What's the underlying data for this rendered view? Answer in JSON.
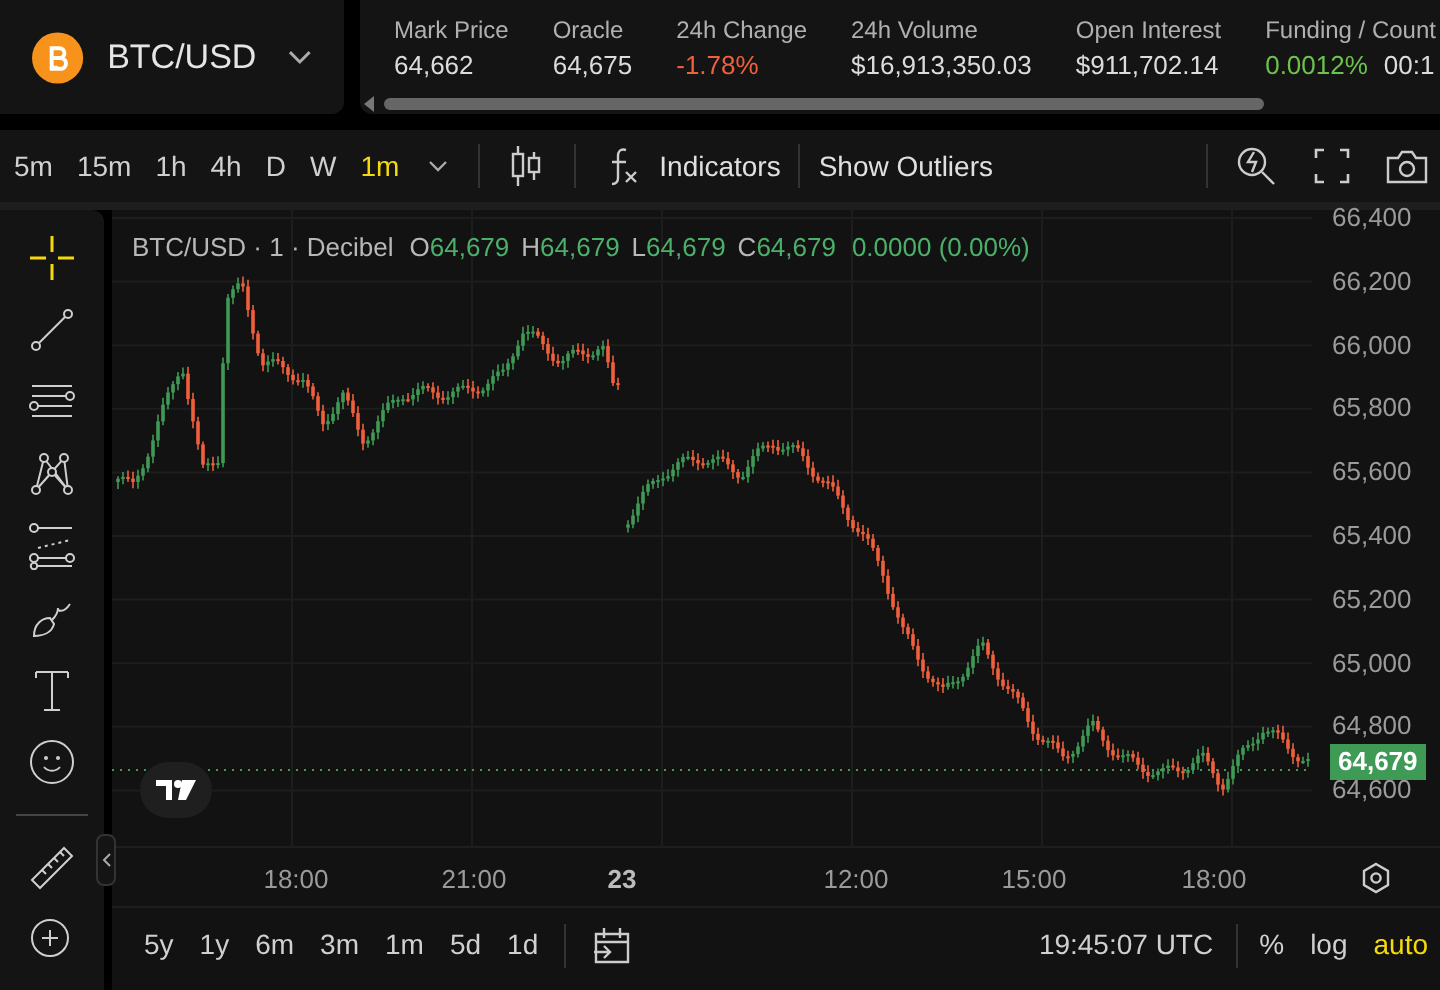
{
  "symbol": {
    "pair": "BTC/USD"
  },
  "stats": [
    {
      "label": "Mark Price",
      "value": "64,662"
    },
    {
      "label": "Oracle",
      "value": "64,675"
    },
    {
      "label": "24h Change",
      "value": "-1.78%",
      "color": "#f0603c"
    },
    {
      "label": "24h Volume",
      "value": "$16,913,350.03"
    },
    {
      "label": "Open Interest",
      "value": "$911,702.14"
    },
    {
      "label": "Funding / Count",
      "value": "0.0012%",
      "color": "#6cc24a",
      "extra": "00:1"
    }
  ],
  "timeframes": [
    {
      "label": "5m",
      "selected": false
    },
    {
      "label": "15m",
      "selected": false
    },
    {
      "label": "1h",
      "selected": false
    },
    {
      "label": "4h",
      "selected": false
    },
    {
      "label": "D",
      "selected": false
    },
    {
      "label": "W",
      "selected": false
    },
    {
      "label": "1m",
      "selected": true
    }
  ],
  "toolbar": {
    "indicators": "Indicators",
    "outliers": "Show Outliers"
  },
  "legend": {
    "title": "BTC/USD · 1 · Decibel",
    "ohlc": [
      {
        "key": "O",
        "value": "64,679"
      },
      {
        "key": "H",
        "value": "64,679"
      },
      {
        "key": "L",
        "value": "64,679"
      },
      {
        "key": "C",
        "value": "64,679"
      }
    ],
    "change": "0.0000 (0.00%)"
  },
  "drawing_tools": [
    {
      "kind": "crosshair",
      "selected": true
    },
    {
      "kind": "trendline",
      "selected": false
    },
    {
      "kind": "hlines",
      "selected": false
    },
    {
      "kind": "pattern",
      "selected": false
    },
    {
      "kind": "fib",
      "selected": false
    },
    {
      "kind": "brush",
      "selected": false
    },
    {
      "kind": "text",
      "selected": false
    },
    {
      "kind": "emoji",
      "selected": false
    },
    {
      "kind": "ruler",
      "selected": false
    },
    {
      "kind": "zoom",
      "selected": false
    }
  ],
  "y_axis": {
    "ticks": [
      "66,400",
      "66,200",
      "66,000",
      "65,800",
      "65,600",
      "65,400",
      "65,200",
      "65,000",
      "64,800",
      "64,600"
    ],
    "current_price": "64,679"
  },
  "x_axis": [
    {
      "label": "18:00",
      "kind": "time"
    },
    {
      "label": "21:00",
      "kind": "time"
    },
    {
      "label": "23",
      "kind": "day"
    },
    {
      "label": "12:00",
      "kind": "time"
    },
    {
      "label": "15:00",
      "kind": "time"
    },
    {
      "label": "18:00",
      "kind": "time"
    }
  ],
  "ranges": [
    "5y",
    "1y",
    "6m",
    "3m",
    "1m",
    "5d",
    "1d"
  ],
  "clock": "19:45:07 UTC",
  "scale_options": [
    {
      "label": "%",
      "selected": false
    },
    {
      "label": "log",
      "selected": false
    },
    {
      "label": "auto",
      "selected": true
    }
  ]
}
